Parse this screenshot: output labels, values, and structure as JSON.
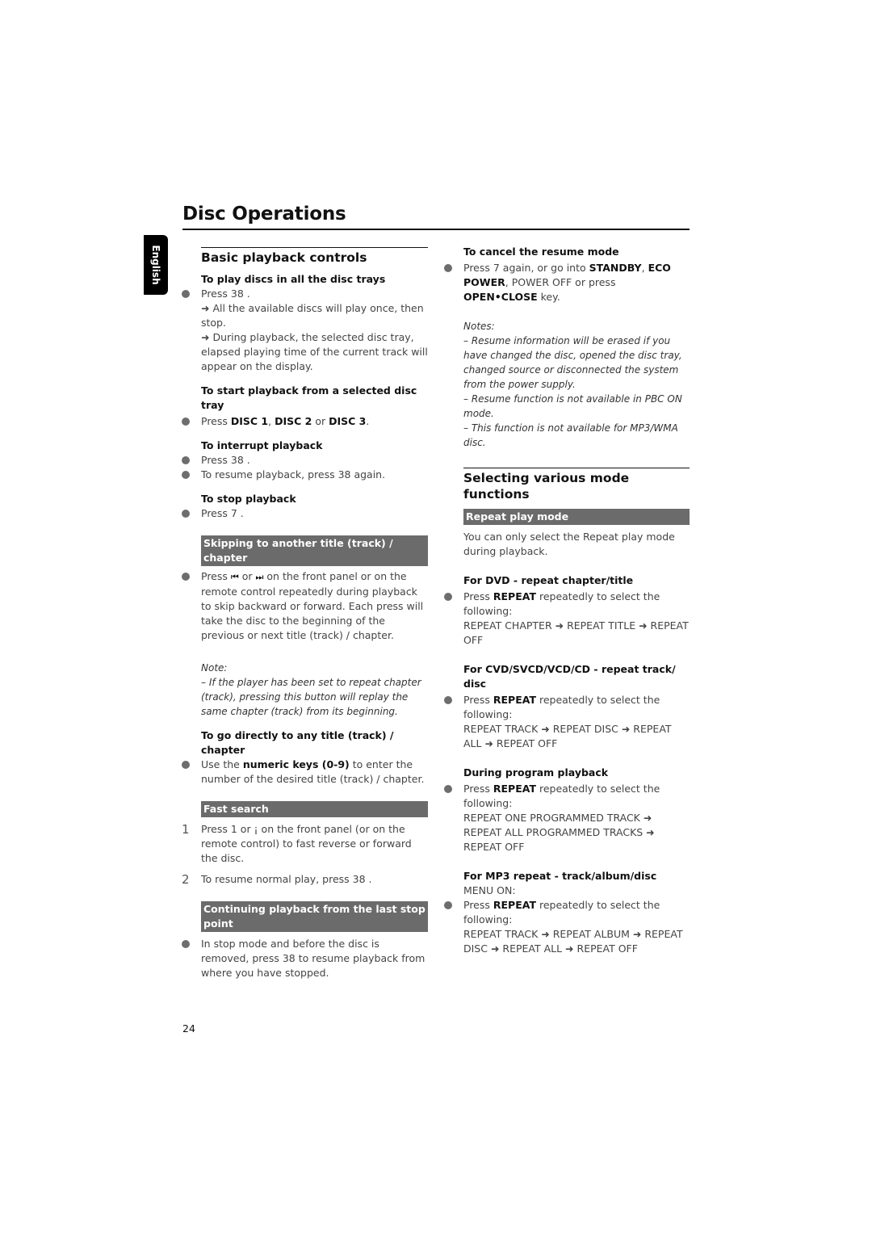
{
  "page": {
    "title": "Disc Operations",
    "language_tab": "English",
    "page_number": "24"
  },
  "left": {
    "section_title": "Basic playback controls",
    "play_all": {
      "heading": "To play discs in all the disc trays",
      "step": "Press 38 .",
      "result1": "➜ All the available discs will play once, then stop.",
      "result2": "➜ During playback, the selected disc tray, elapsed playing time of the current track will appear on the display."
    },
    "play_selected": {
      "heading": "To start playback from a selected disc tray",
      "press": "Press ",
      "disc1": "DISC 1",
      "sep1": ", ",
      "disc2": "DISC 2",
      "or": " or ",
      "disc3": "DISC 3",
      "end": "."
    },
    "interrupt": {
      "heading": "To interrupt playback",
      "step1": "Press 38 .",
      "step2": "To resume playback, press 38   again."
    },
    "stop": {
      "heading": "To stop playback",
      "step": "Press 7 ."
    },
    "skipping": {
      "bar": "Skipping to another title (track) / chapter",
      "press": "Press ",
      "prev_icon": "⏮",
      "or": " or ",
      "next_icon": "⏭",
      "rest": " on the front panel or on the remote control repeatedly during playback to skip backward or forward. Each press will take the disc to the beginning of the previous or next title (track) / chapter.",
      "note_label": "Note:",
      "note": "–  If the player has been set to repeat chapter (track), pressing this button will replay the same chapter (track) from its beginning."
    },
    "direct": {
      "heading": "To go directly to any title (track) / chapter",
      "pre": "Use the ",
      "keys": "numeric keys (0-9)",
      "post": " to enter the number of the desired title (track)  / chapter."
    },
    "fast_search": {
      "bar": "Fast search",
      "step1_num": "1",
      "step1": "Press  1     or  ¡      on the front panel (or on the remote control) to fast reverse or forward the disc.",
      "step2_num": "2",
      "step2": "To resume normal play, press 38 ."
    },
    "continuing": {
      "bar": "Continuing playback from the last stop point",
      "step": "In stop mode and before the disc is removed, press 38   to resume playback from where you have stopped."
    }
  },
  "right": {
    "cancel_resume": {
      "heading": "To cancel the resume mode",
      "pre": "Press 7  again, or go into ",
      "standby": "STANDBY",
      "sep": ", ",
      "eco": "ECO POWER",
      "mid": ", POWER OFF   or press ",
      "open_close": "OPEN•CLOSE",
      "post": " key.",
      "notes_label": "Notes:",
      "notes": [
        "–  Resume information will be erased if you have changed the disc, opened the disc tray, changed source or disconnected the system from the power supply.",
        "–  Resume function is not available in PBC ON mode.",
        "–  This function is not available for MP3/WMA disc."
      ]
    },
    "section_title": "Selecting various mode functions",
    "repeat": {
      "bar": "Repeat play mode",
      "intro": "You can only select the Repeat play mode during playback.",
      "press": "Press ",
      "key": "REPEAT",
      "post": " repeatedly to select the following:",
      "dvd": {
        "heading": "For DVD - repeat chapter/title",
        "sequence": "REPEAT CHAPTER ➜ REPEAT TITLE ➜ REPEAT OFF"
      },
      "cvd": {
        "heading": "For CVD/SVCD/VCD/CD - repeat track/ disc",
        "sequence": "REPEAT TRACK ➜ REPEAT DISC ➜ REPEAT ALL ➜ REPEAT OFF"
      },
      "program": {
        "heading": "During program playback",
        "sequence": "REPEAT ONE PROGRAMMED TRACK ➜ REPEAT ALL PROGRAMMED TRACKS ➜ REPEAT OFF"
      },
      "mp3": {
        "heading": "For MP3 repeat - track/album/disc",
        "menu": "MENU ON:",
        "sequence": "REPEAT TRACK ➜ REPEAT ALBUM ➜ REPEAT DISC ➜ REPEAT ALL ➜ REPEAT OFF"
      }
    }
  }
}
